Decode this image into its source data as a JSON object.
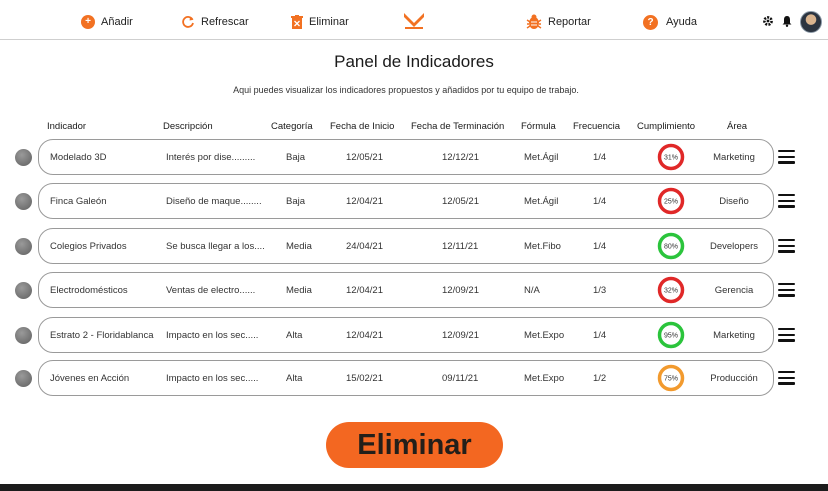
{
  "toolbar": {
    "add_label": "Añadir",
    "refresh_label": "Refrescar",
    "delete_label": "Eliminar",
    "report_label": "Reportar",
    "help_label": "Ayuda",
    "add_icon": "+",
    "help_icon": "?"
  },
  "colors": {
    "accent": "#f27122",
    "low": "#e02828",
    "high": "#2bc43c",
    "mid": "#f29a2e"
  },
  "page": {
    "title": "Panel de Indicadores",
    "subtitle": "Aqui puedes visualizar los indicadores propuestos y añadidos por tu equipo de trabajo."
  },
  "table": {
    "headers": [
      "Indicador",
      "Descripción",
      "Categoría",
      "Fecha de Inicio",
      "Fecha de Terminación",
      "Fórmula",
      "Frecuencia",
      "Cumplimiento",
      "Área"
    ],
    "rows": [
      {
        "indicador": "Modelado 3D",
        "descripcion": "Interés por dise.........",
        "categoria": "Baja",
        "inicio": "12/05/21",
        "fin": "12/12/21",
        "formula": "Met.Ágil",
        "frecuencia": "1/4",
        "cumplimiento": "31%",
        "area": "Marketing",
        "level": 0.31,
        "status": "low"
      },
      {
        "indicador": "Finca Galeón",
        "descripcion": "Diseño de maque........",
        "categoria": "Baja",
        "inicio": "12/04/21",
        "fin": "12/05/21",
        "formula": "Met.Ágil",
        "frecuencia": "1/4",
        "cumplimiento": "25%",
        "area": "Diseño",
        "level": 0.25,
        "status": "low"
      },
      {
        "indicador": "Colegios Privados",
        "descripcion": "Se busca llegar a los....",
        "categoria": "Media",
        "inicio": "24/04/21",
        "fin": "12/11/21",
        "formula": "Met.Fibo",
        "frecuencia": "1/4",
        "cumplimiento": "80%",
        "area": "Developers",
        "level": 0.8,
        "status": "high"
      },
      {
        "indicador": "Electrodomésticos",
        "descripcion": "Ventas de electro......",
        "categoria": "Media",
        "inicio": "12/04/21",
        "fin": "12/09/21",
        "formula": "N/A",
        "frecuencia": "1/3",
        "cumplimiento": "32%",
        "area": "Gerencia",
        "level": 0.32,
        "status": "low"
      },
      {
        "indicador": "Estrato 2 - Floridablanca",
        "descripcion": "Impacto en los sec.....",
        "categoria": "Alta",
        "inicio": "12/04/21",
        "fin": "12/09/21",
        "formula": "Met.Expo",
        "frecuencia": "1/4",
        "cumplimiento": "95%",
        "area": "Marketing",
        "level": 0.95,
        "status": "high"
      },
      {
        "indicador": "Jóvenes en Acción",
        "descripcion": "Impacto en los sec.....",
        "categoria": "Alta",
        "inicio": "15/02/21",
        "fin": "09/11/21",
        "formula": "Met.Expo",
        "frecuencia": "1/2",
        "cumplimiento": "75%",
        "area": "Producción",
        "level": 0.75,
        "status": "mid"
      }
    ]
  },
  "delete_button": {
    "label": "Eliminar"
  }
}
